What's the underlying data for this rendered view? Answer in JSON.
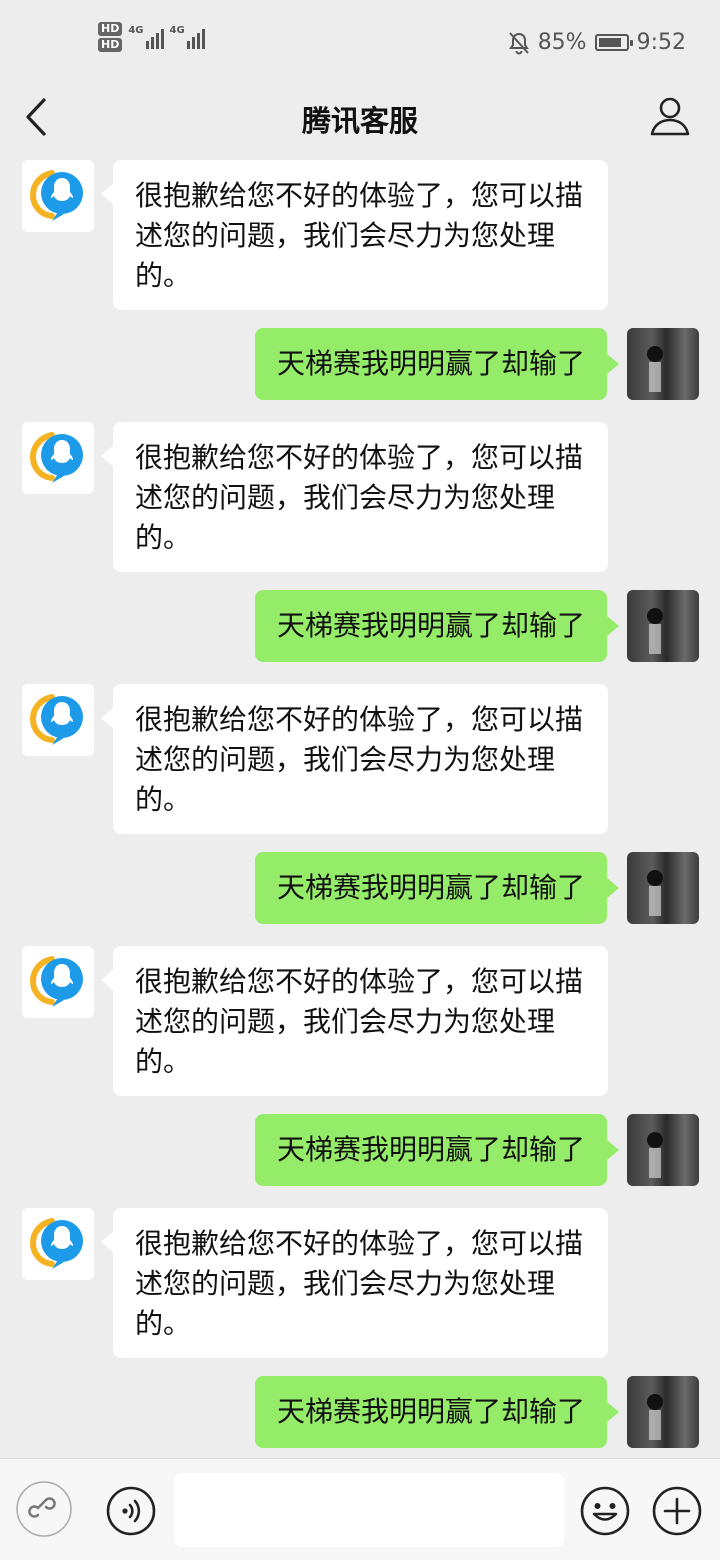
{
  "status_bar": {
    "hd1": "HD",
    "hd2": "HD",
    "net1": "4G",
    "net2": "4G",
    "battery_percent": "85%",
    "battery_level": 0.85,
    "time": "9:52"
  },
  "nav": {
    "title": "腾讯客服"
  },
  "messages": [
    {
      "side": "left",
      "text": "很抱歉给您不好的体验了，您可以描述您的问题，我们会尽力为您处理的。"
    },
    {
      "side": "right",
      "text": "天梯赛我明明赢了却输了"
    },
    {
      "side": "left",
      "text": "很抱歉给您不好的体验了，您可以描述您的问题，我们会尽力为您处理的。"
    },
    {
      "side": "right",
      "text": "天梯赛我明明赢了却输了"
    },
    {
      "side": "left",
      "text": "很抱歉给您不好的体验了，您可以描述您的问题，我们会尽力为您处理的。"
    },
    {
      "side": "right",
      "text": "天梯赛我明明赢了却输了"
    },
    {
      "side": "left",
      "text": "很抱歉给您不好的体验了，您可以描述您的问题，我们会尽力为您处理的。"
    },
    {
      "side": "right",
      "text": "天梯赛我明明赢了却输了"
    },
    {
      "side": "left",
      "text": "很抱歉给您不好的体验了，您可以描述您的问题，我们会尽力为您处理的。"
    },
    {
      "side": "right",
      "text": "天梯赛我明明赢了却输了"
    }
  ],
  "input": {
    "value": ""
  },
  "colors": {
    "page_bg": "#ededed",
    "sent_bubble": "#95ec69",
    "received_bubble": "#ffffff",
    "qq_blue": "#1e9be8",
    "qq_yellow": "#f5b323"
  }
}
